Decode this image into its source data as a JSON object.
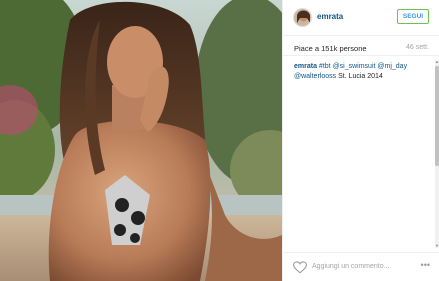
{
  "post": {
    "username": "emrata",
    "follow_label": "SEGUI",
    "likes": "Piace a 151k persone",
    "time": "46 sett.",
    "caption": {
      "user": "emrata",
      "hashtag": "#tbt",
      "mentions": [
        "@si_swimsuit",
        "@mj_day",
        "@walterlooss"
      ],
      "place": "St. Lucia 2014"
    },
    "comment_placeholder": "Aggiungi un commento...",
    "more_label": "•••"
  },
  "icons": {
    "like": "heart-icon",
    "more": "more-options-icon"
  },
  "colors": {
    "link": "#125688",
    "follow_border": "#70c050",
    "follow_text": "#3897f0"
  }
}
